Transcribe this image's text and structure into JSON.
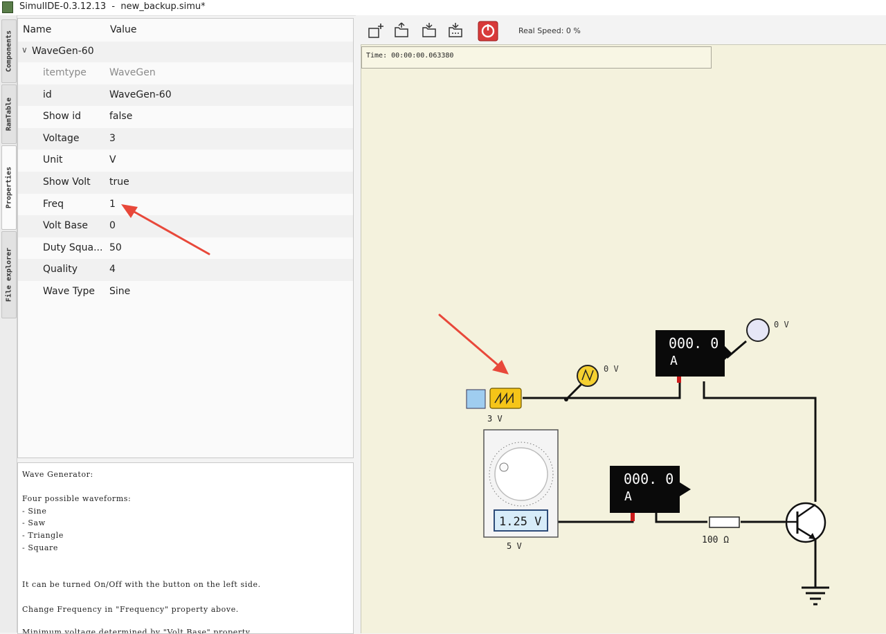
{
  "window": {
    "title": "SimulIDE-0.3.12.13  -  new_backup.simu*"
  },
  "side_tabs": [
    "Components",
    "RamTable",
    "Properties",
    "File explorer"
  ],
  "properties": {
    "header": {
      "name": "Name",
      "value": "Value"
    },
    "group": "WaveGen-60",
    "rows": [
      {
        "name": "itemtype",
        "value": "WaveGen"
      },
      {
        "name": "id",
        "value": "WaveGen-60"
      },
      {
        "name": "Show id",
        "value": "false"
      },
      {
        "name": "Voltage",
        "value": "3"
      },
      {
        "name": "Unit",
        "value": " V"
      },
      {
        "name": "Show Volt",
        "value": "true"
      },
      {
        "name": "Freq",
        "value": "1"
      },
      {
        "name": "Volt Base",
        "value": "0"
      },
      {
        "name": "Duty Squa...",
        "value": "50"
      },
      {
        "name": "Quality",
        "value": "4"
      },
      {
        "name": "Wave Type",
        "value": "Sine"
      }
    ]
  },
  "help": {
    "lines": [
      "Wave Generator:",
      "",
      "Four possible waveforms:",
      "- Sine",
      "- Saw",
      "- Triangle",
      "- Square",
      "",
      "",
      "It can be turned On/Off with the button on the left side.",
      "",
      "Change Frequency in \"Frequency\" property above.",
      "",
      "Minimum voltage determined by \"Volt Base\" property."
    ]
  },
  "toolbar": {
    "buttons": [
      "new-circuit-icon",
      "open-circuit-icon",
      "save-circuit-icon",
      "save-as-icon",
      "power-icon"
    ],
    "real_speed": "Real Speed: 0 %",
    "power_color": "#d83a3a"
  },
  "canvas": {
    "time": "Time: 00:00:00.063380",
    "meter1": {
      "value": "000. 0",
      "unit": "A"
    },
    "meter2": {
      "value": "000. 0",
      "unit": "A"
    },
    "probe1_label": "0 V",
    "probe2_label": "0 V",
    "wavegen_label": "3 V",
    "supply_display": "1.25 V",
    "supply_label": "5 V",
    "resistor_label": "100  Ω"
  },
  "colors": {
    "canvas_bg": "#f4f2dd",
    "wavegen": "#f5c518",
    "annotation": "#e8483a"
  }
}
